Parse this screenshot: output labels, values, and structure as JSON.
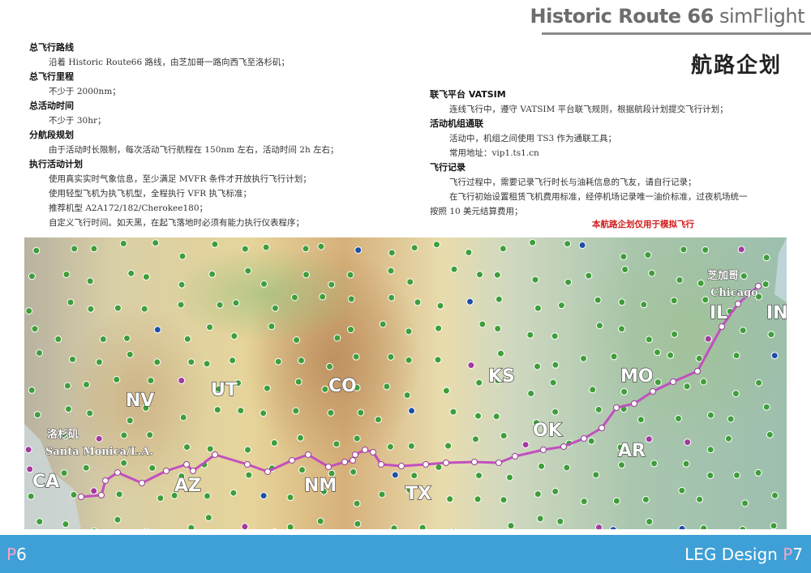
{
  "header": {
    "title_bold": "Historic Route 66",
    "title_light": "simFlight",
    "page_title": "航路企划"
  },
  "left_column": [
    {
      "heading": "总飞行路线",
      "lines": [
        "沿着 Historic Route66 路线，由芝加哥一路向西飞至洛杉矶；"
      ]
    },
    {
      "heading": "总飞行里程",
      "lines": [
        "不少于 2000nm；"
      ]
    },
    {
      "heading": "总活动时间",
      "lines": [
        "不少于 30hr；"
      ]
    },
    {
      "heading": "分航段规划",
      "lines": [
        "由于活动时长限制，每次活动飞行航程在 150nm 左右，活动时间 2h 左右；"
      ]
    },
    {
      "heading": "执行活动计划",
      "lines": [
        "使用真实实时气象信息，至少满足 MVFR 条件才开放执行飞行计划；",
        "使用轻型飞机为执飞机型，全程执行 VFR 执飞标准；",
        "推荐机型 A2A172/182/Cherokee180；",
        "自定义飞行时间。如天黑，在起飞落地时必须有能力执行仪表程序；"
      ]
    }
  ],
  "right_column": [
    {
      "heading": "联飞平台 VATSIM",
      "lines": [
        "连线飞行中，遵守 VATSIM 平台联飞规则，根据航段计划提交飞行计划；"
      ]
    },
    {
      "heading": "活动机组通联",
      "lines": [
        "活动中，机组之间使用 TS3 作为通联工具；",
        "常用地址：vip1.ts1.cn"
      ]
    },
    {
      "heading": "飞行记录",
      "lines": [
        "飞行过程中，需要记录飞行时长与油耗信息的飞友，请自行记录；",
        "在飞行初始设置租赁飞机费用标准，经停机场记录唯一油价标准，过夜机场统一",
        "按照 10 美元结算费用；"
      ]
    }
  ],
  "note": "本航路企划仅用于模拟飞行",
  "map": {
    "states": [
      "CA",
      "NV",
      "UT",
      "AZ",
      "CO",
      "NM",
      "TX",
      "KS",
      "OK",
      "MO",
      "AR",
      "IL",
      "IN"
    ],
    "city_start_cn": "洛杉矶",
    "city_start_en": "Santa Monica/L.A.",
    "city_end_cn": "芝加哥",
    "city_end_en": "Chicago",
    "route_color": "#c24fbf"
  },
  "footer": {
    "left_prefix": "P",
    "left_num": "6",
    "right_label": "LEG Design",
    "right_prefix": "P",
    "right_num": "7"
  }
}
